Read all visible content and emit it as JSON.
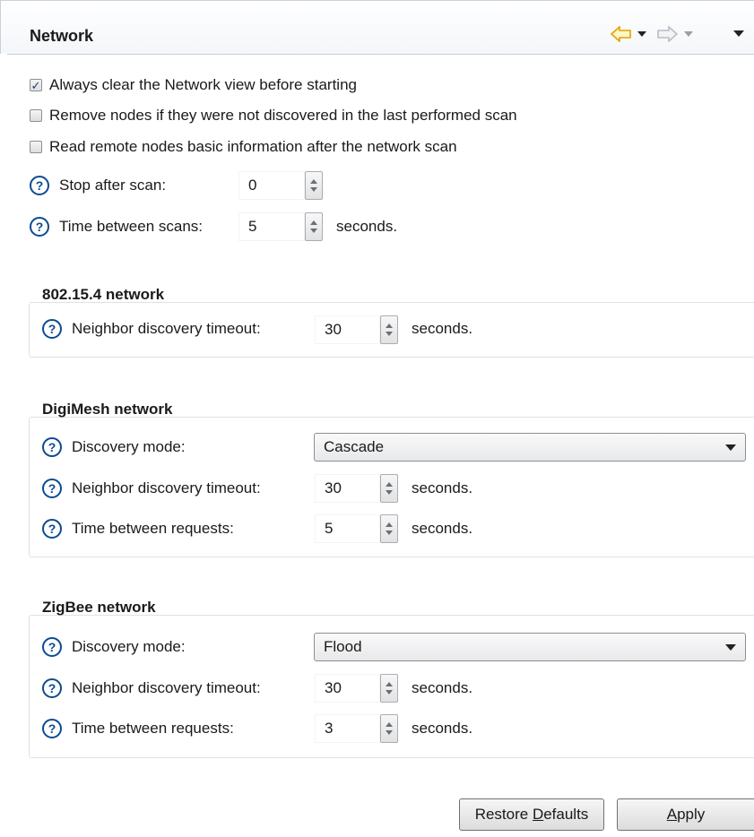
{
  "header": {
    "title": "Network"
  },
  "general": {
    "clear_view": {
      "label": "Always clear the Network view before starting",
      "checked": true
    },
    "remove_nodes": {
      "label": "Remove nodes if they were not discovered in the last performed scan",
      "checked": false
    },
    "read_remote": {
      "label": "Read remote nodes basic information after the network scan",
      "checked": false
    },
    "stop_after": {
      "label": "Stop after scan:",
      "value": "0"
    },
    "time_between": {
      "label": "Time between scans:",
      "value": "5",
      "unit": "seconds."
    }
  },
  "net802": {
    "title": "802.15.4 network",
    "timeout": {
      "label": "Neighbor discovery timeout:",
      "value": "30",
      "unit": "seconds."
    }
  },
  "digimesh": {
    "title": "DigiMesh network",
    "mode": {
      "label": "Discovery mode:",
      "value": "Cascade"
    },
    "timeout": {
      "label": "Neighbor discovery timeout:",
      "value": "30",
      "unit": "seconds."
    },
    "requests": {
      "label": "Time between requests:",
      "value": "5",
      "unit": "seconds."
    }
  },
  "zigbee": {
    "title": "ZigBee network",
    "mode": {
      "label": "Discovery mode:",
      "value": "Flood"
    },
    "timeout": {
      "label": "Neighbor discovery timeout:",
      "value": "30",
      "unit": "seconds."
    },
    "requests": {
      "label": "Time between requests:",
      "value": "3",
      "unit": "seconds."
    }
  },
  "buttons": {
    "restore_pre": "Restore ",
    "restore_mnemonic": "D",
    "restore_post": "efaults",
    "apply_mnemonic": "A",
    "apply_post": "pply"
  },
  "icons": {
    "back": "back-arrow-icon",
    "forward": "forward-arrow-icon",
    "menu": "view-menu-icon",
    "help": "help-icon",
    "spinner": "spinner-arrows-icon",
    "dropdown": "dropdown-caret-icon"
  },
  "colors": {
    "help_icon": "#0c4a93",
    "back_arrow": "#f0b400"
  }
}
